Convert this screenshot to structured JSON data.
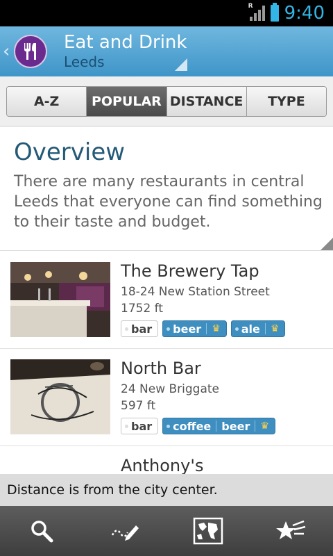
{
  "status_bar": {
    "time": "9:40",
    "signal_label": "R"
  },
  "header": {
    "title": "Eat and Drink",
    "subtitle": "Leeds"
  },
  "tabs": [
    {
      "label": "A-Z",
      "active": false
    },
    {
      "label": "POPULAR",
      "active": true
    },
    {
      "label": "DISTANCE",
      "active": false
    },
    {
      "label": "TYPE",
      "active": false
    }
  ],
  "overview": {
    "title": "Overview",
    "text": "There are many restaurants in central Leeds that everyone can find something to their taste and budget."
  },
  "items": [
    {
      "name": "The Brewery Tap",
      "address": "18-24 New Station Street",
      "distance": "1752 ft",
      "tags": [
        {
          "label": "bar",
          "style": "plain"
        },
        {
          "label": "beer",
          "style": "blue"
        },
        {
          "label": "ale",
          "style": "blue"
        }
      ]
    },
    {
      "name": "North Bar",
      "address": "24 New Briggate",
      "distance": "597 ft",
      "tags": [
        {
          "label": "bar",
          "style": "plain"
        },
        {
          "label": "coffee",
          "style": "blue"
        },
        {
          "label": "beer",
          "style": "blue"
        }
      ]
    },
    {
      "name": "Anthony's"
    }
  ],
  "toast": "Distance is from the city center.",
  "bottom_bar": [
    "search-icon",
    "edit-icon",
    "map-icon",
    "favorites-icon"
  ],
  "colors": {
    "accent": "#33b5e5",
    "header": "#3f95c8",
    "tag_blue": "#3f8ec0",
    "title": "#245a78"
  }
}
